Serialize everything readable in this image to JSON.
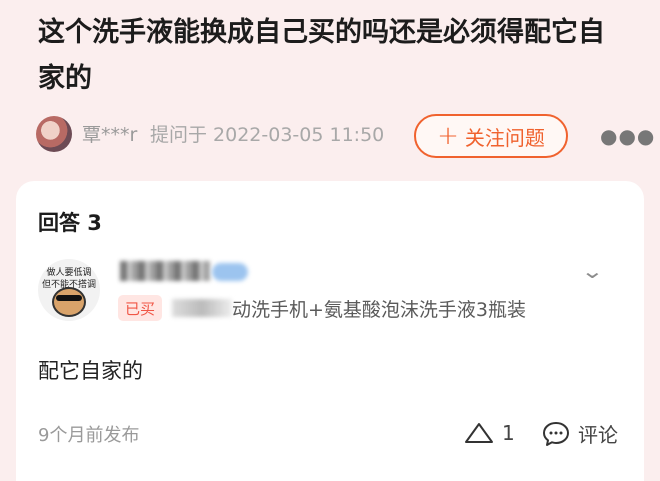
{
  "question": {
    "title": "这个洗手液能换成自己买的吗还是必须得配它自家的",
    "asker_name": "覃***r",
    "asked_time": "提问于 2022-03-05 11:50",
    "follow_label": "关注问题",
    "follow_icon": "plus-icon",
    "more_icon": "more-dots-icon"
  },
  "answers": {
    "header": "回答 3",
    "items": [
      {
        "avatar_caption_1": "做人要低调",
        "avatar_caption_2": "但不能不搭调",
        "bought_tag": "已买",
        "product": "动洗手机+氨基酸泡沫洗手液3瓶装",
        "text": "配它自家的",
        "time": "9个月前发布",
        "likes": "1",
        "comment_label": "评论"
      }
    ]
  }
}
